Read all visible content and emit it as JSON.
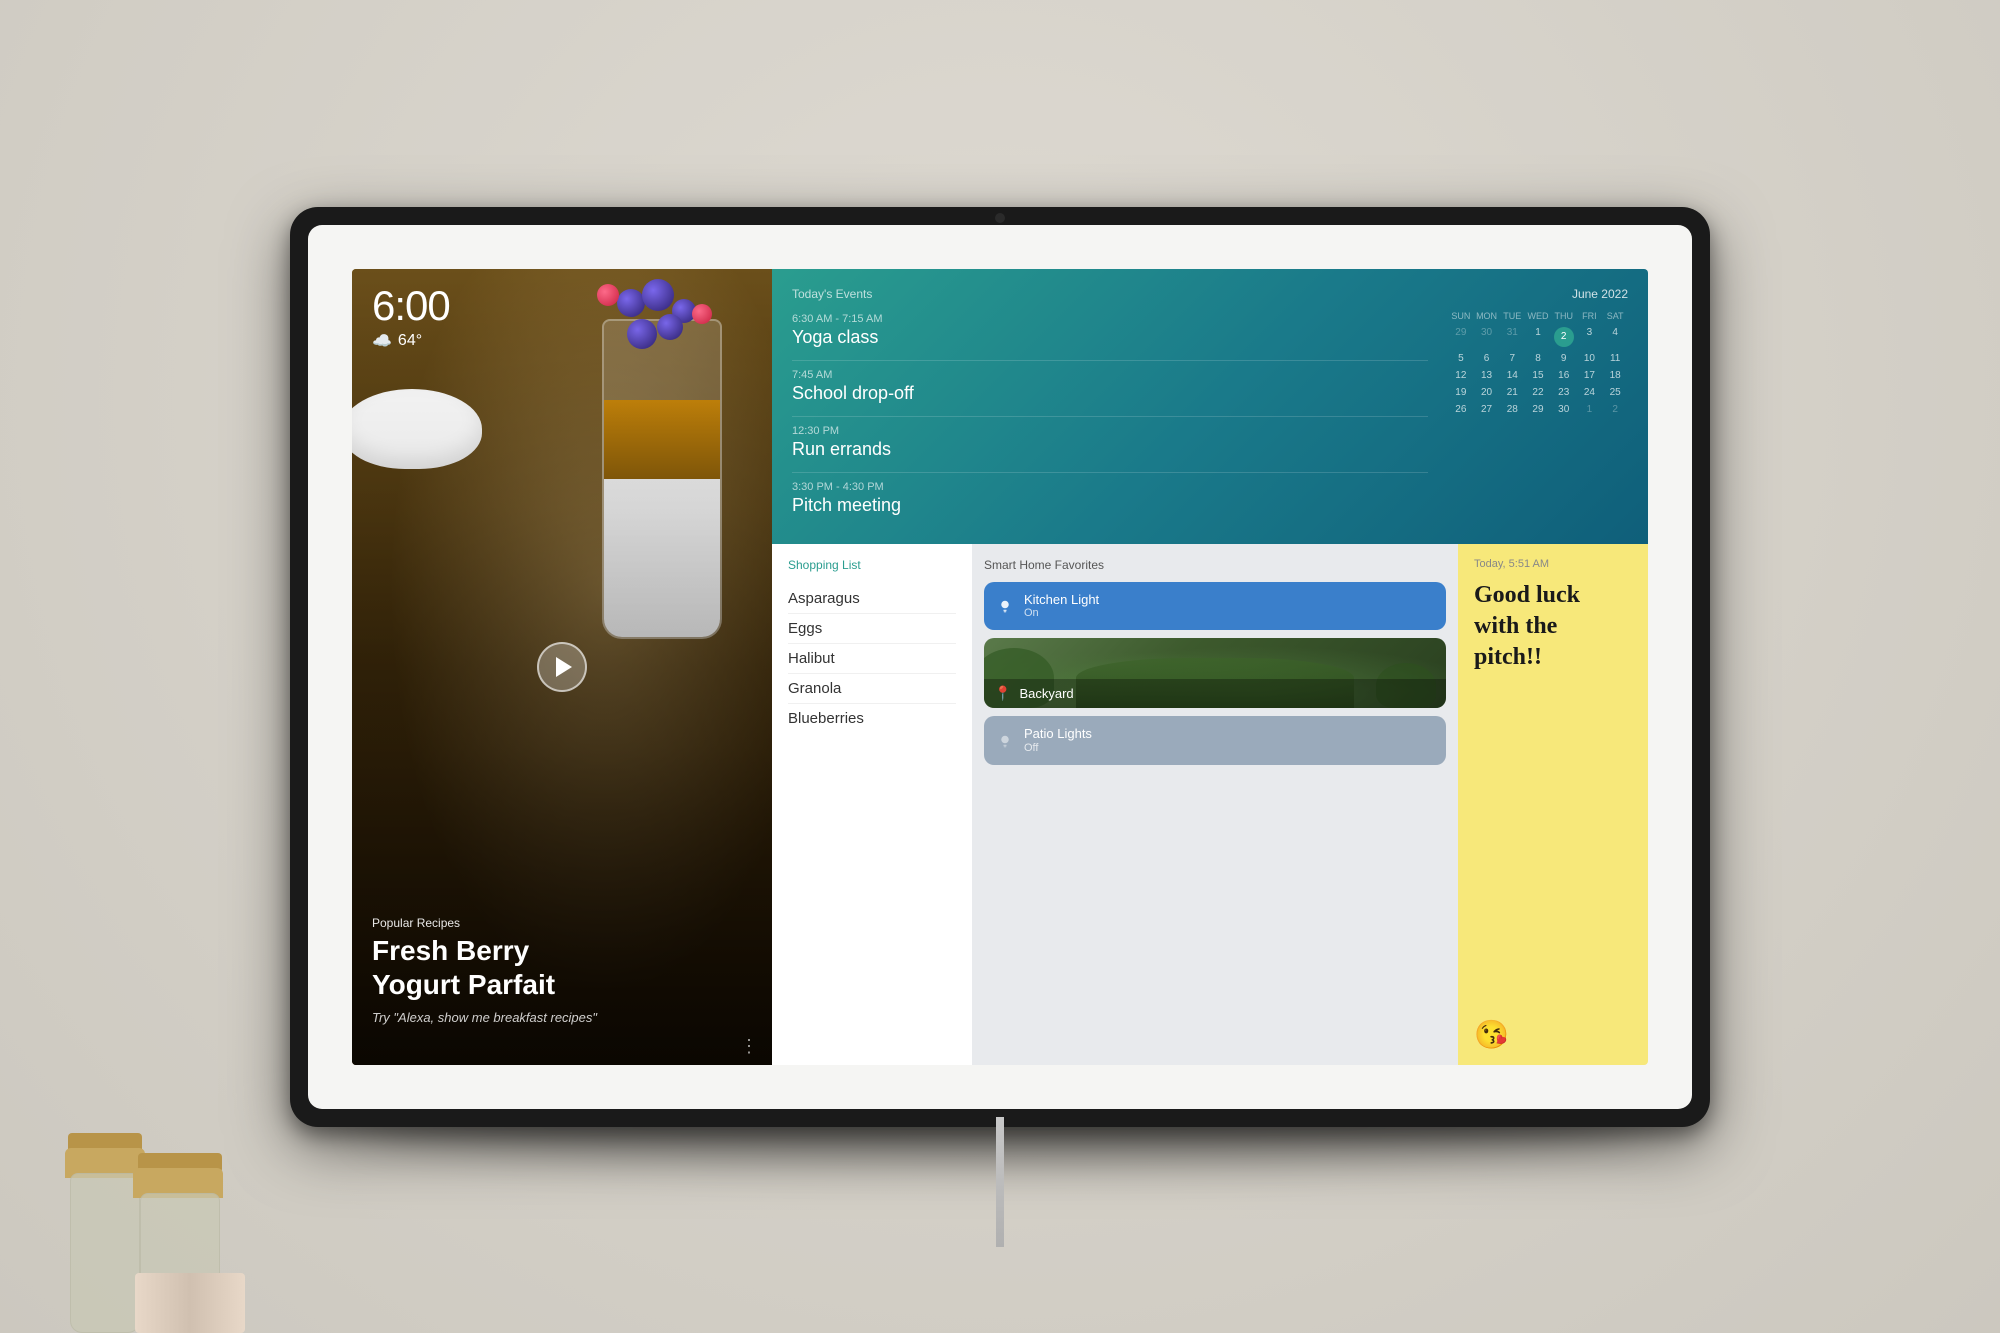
{
  "device": {
    "time": "6:00",
    "weather": {
      "icon": "☁",
      "temperature": "64°"
    }
  },
  "recipe": {
    "category": "Popular Recipes",
    "title": "Fresh Berry\nYogurt Parfait",
    "hint": "Try \"Alexa, show me breakfast recipes\""
  },
  "events": {
    "section_title": "Today's Events",
    "items": [
      {
        "time": "6:30 AM - 7:15 AM",
        "name": "Yoga class"
      },
      {
        "time": "7:45 AM",
        "name": "School drop-off"
      },
      {
        "time": "12:30 PM",
        "name": "Run errands"
      },
      {
        "time": "3:30 PM - 4:30 PM",
        "name": "Pitch meeting"
      }
    ]
  },
  "calendar": {
    "title": "June 2022",
    "day_labels": [
      "SUN",
      "MON",
      "TUE",
      "WED",
      "THU",
      "FRI",
      "SAT"
    ],
    "weeks": [
      [
        "29",
        "30",
        "31",
        "1",
        "2",
        "3",
        "4"
      ],
      [
        "5",
        "6",
        "7",
        "8",
        "9",
        "10",
        "11"
      ],
      [
        "12",
        "13",
        "14",
        "15",
        "16",
        "17",
        "18"
      ],
      [
        "19",
        "20",
        "21",
        "22",
        "23",
        "24",
        "25"
      ],
      [
        "26",
        "27",
        "28",
        "29",
        "30",
        "1",
        "2"
      ]
    ],
    "today": "2",
    "today_week": 0,
    "today_day_index": 4
  },
  "shopping": {
    "title": "Shopping List",
    "items": [
      "Asparagus",
      "Eggs",
      "Halibut",
      "Granola",
      "Blueberries"
    ]
  },
  "smarthome": {
    "title": "Smart Home Favorites",
    "devices": [
      {
        "name": "Kitchen Light",
        "status": "On",
        "type": "active"
      },
      {
        "name": "Backyard",
        "status": "",
        "type": "image"
      },
      {
        "name": "Patio Lights",
        "status": "Off",
        "type": "inactive"
      }
    ]
  },
  "note": {
    "time": "Today, 5:51 AM",
    "text": "Good luck\nwith the\npitch!!",
    "emoji": "😘"
  },
  "colors": {
    "teal": "#2a9d8f",
    "dark_teal": "#1a7a8a",
    "blue_card": "#3a7fcb",
    "gray_card": "#9aaabb",
    "sticky_yellow": "#f7e87a"
  }
}
